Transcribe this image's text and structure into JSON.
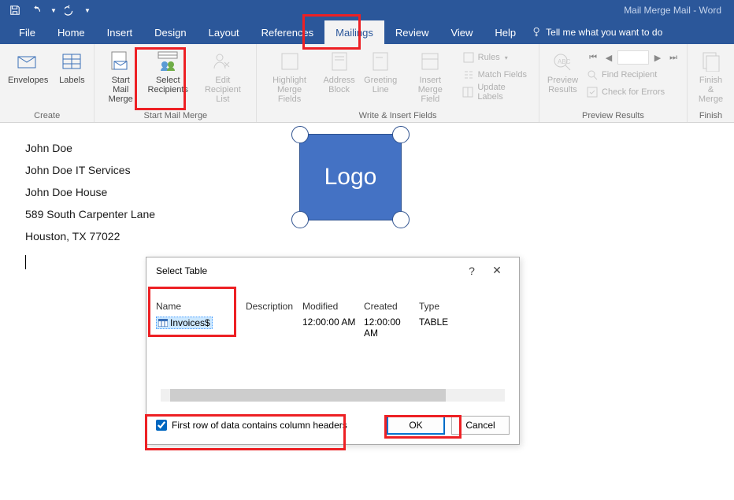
{
  "app_title": "Mail Merge Mail  -  Word",
  "tabs": {
    "file": "File",
    "home": "Home",
    "insert": "Insert",
    "design": "Design",
    "layout": "Layout",
    "references": "References",
    "mailings": "Mailings",
    "review": "Review",
    "view": "View",
    "help": "Help"
  },
  "tellme": "Tell me what you want to do",
  "ribbon": {
    "create": {
      "label": "Create",
      "envelopes": "Envelopes",
      "labels": "Labels"
    },
    "start": {
      "label": "Start Mail Merge",
      "start_mail_merge": "Start Mail\nMerge",
      "select_recipients": "Select\nRecipients",
      "edit_recipient_list": "Edit\nRecipient List"
    },
    "write": {
      "label": "Write & Insert Fields",
      "highlight": "Highlight\nMerge Fields",
      "address_block": "Address\nBlock",
      "greeting_line": "Greeting\nLine",
      "insert_merge": "Insert Merge\nField",
      "rules": "Rules",
      "match": "Match Fields",
      "update": "Update Labels"
    },
    "preview": {
      "label": "Preview Results",
      "preview_results": "Preview\nResults",
      "find_recipient": "Find Recipient",
      "check_errors": "Check for Errors"
    },
    "finish": {
      "label": "Finish",
      "finish_merge": "Finish &\nMerge"
    }
  },
  "doc": {
    "lines": [
      "John Doe",
      "John Doe IT Services",
      "John Doe House",
      "589 South Carpenter Lane",
      "Houston, TX 77022"
    ],
    "logo_text": "Logo"
  },
  "dialog": {
    "title": "Select Table",
    "cols": {
      "name": "Name",
      "description": "Description",
      "modified": "Modified",
      "created": "Created",
      "type": "Type"
    },
    "row": {
      "name": "Invoices$",
      "description": "",
      "modified": "12:00:00 AM",
      "created": "12:00:00 AM",
      "type": "TABLE"
    },
    "checkbox_label": "First row of data contains column headers",
    "checkbox_checked": true,
    "ok": "OK",
    "cancel": "Cancel"
  }
}
